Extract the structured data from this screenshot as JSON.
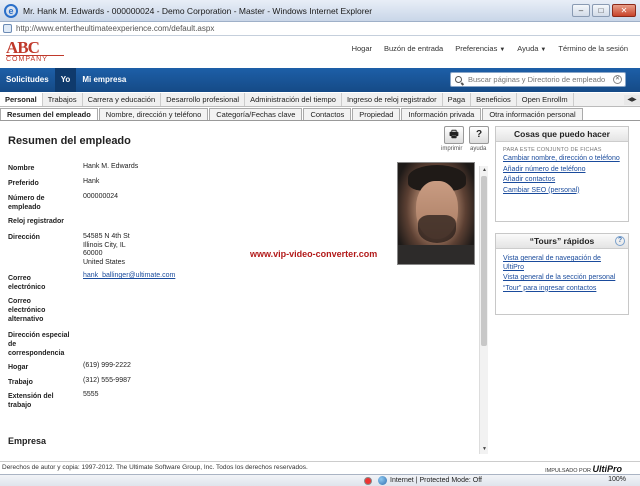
{
  "window": {
    "title": "Mr. Hank M. Edwards - 000000024 - Demo Corporation - Master - Windows Internet Explorer",
    "url": "http://www.entertheultimateexperience.com/default.aspx"
  },
  "logo": {
    "line1": "ABC",
    "line2": "COMPANY"
  },
  "top_links": [
    "Hogar",
    "Buzón de entrada",
    "Preferencias",
    "Ayuda",
    "Término de la sesión"
  ],
  "nav": {
    "items": [
      "Solicitudes",
      "Yo",
      "Mi empresa"
    ],
    "active": "Yo",
    "search_placeholder": "Buscar páginas y Directorio de empleado"
  },
  "tabs_primary": [
    "Personal",
    "Trabajos",
    "Carrera y educación",
    "Desarrollo profesional",
    "Administración del tiempo",
    "Ingreso de reloj registrador",
    "Paga",
    "Beneficios",
    "Open Enrollm"
  ],
  "tabs_secondary": [
    "Resumen del empleado",
    "Nombre, dirección y teléfono",
    "Categoría/Fechas clave",
    "Contactos",
    "Propiedad",
    "Información privada",
    "Otra información personal"
  ],
  "main": {
    "title": "Resumen del empleado",
    "print_label": "imprimir",
    "help_label": "ayuda",
    "fields": {
      "nombre": {
        "label": "Nombre",
        "value": "Hank M. Edwards"
      },
      "preferido": {
        "label": "Preferido",
        "value": "Hank"
      },
      "numero": {
        "label": "Número de empleado",
        "value": "000000024"
      },
      "reloj": {
        "label": "Reloj registrador",
        "value": ""
      },
      "direccion": {
        "label": "Dirección",
        "line1": "54585 N 4th St",
        "line2": "Illinois City, IL",
        "line3": "60000",
        "line4": "United States"
      },
      "correo": {
        "label": "Correo electrónico",
        "value": "hank_ballinger@ultimate.com"
      },
      "correo_alt": {
        "label": "Correo electrónico alternativo",
        "value": ""
      },
      "direccion_esp": {
        "label": "Dirección especial de correspondencia",
        "value": ""
      },
      "hogar": {
        "label": "Hogar",
        "value": "(619) 999-2222"
      },
      "trabajo": {
        "label": "Trabajo",
        "value": "(312) 555-9987"
      },
      "extension": {
        "label": "Extensión del trabajo",
        "value": "5555"
      }
    },
    "watermark": "www.vip-video-converter.com",
    "section_empresa": "Empresa"
  },
  "panel_cosas": {
    "title": "Cosas que puedo hacer",
    "subtitle": "PARA ESTE CONJUNTO DE FICHAS",
    "links": [
      "Cambiar nombre, dirección o teléfono",
      "Añadir número de teléfono",
      "Añadir contactos",
      "Cambiar SEO (personal)"
    ]
  },
  "panel_tours": {
    "title": "“Tours” rápidos",
    "links": [
      "Vista general de navegación de UltiPro",
      "Vista general de la sección personal",
      "“Tour” para ingresar contactos"
    ]
  },
  "footer": {
    "copyright": "Derechos de autor y copia: 1997-2012. The Ultimate Software Group, Inc. Todos los derechos reservados.",
    "powered": "IMPULSADO POR",
    "brand": "UltiPro"
  },
  "statusbar": {
    "zone": "Internet | Protected Mode: Off",
    "zoom": "100%"
  }
}
